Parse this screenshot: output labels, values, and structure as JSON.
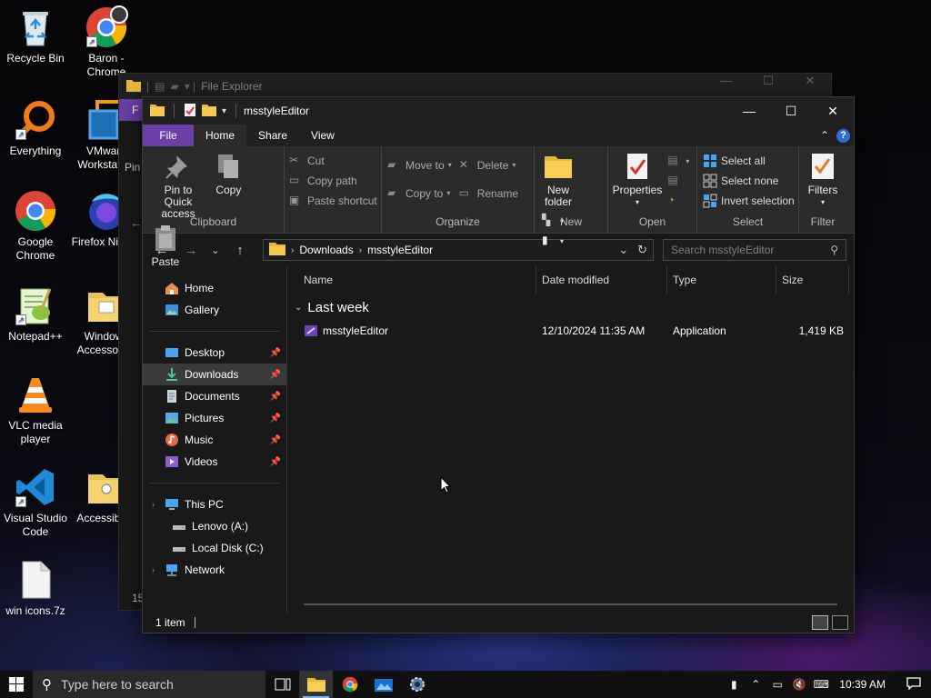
{
  "desktop": {
    "icons": [
      {
        "label": "Recycle Bin",
        "icon": "recycle-bin-icon"
      },
      {
        "label": "Baron - Chrome",
        "icon": "chrome-profile-icon"
      },
      {
        "label": "Everything",
        "icon": "everything-search-icon"
      },
      {
        "label": "VMware Workstation",
        "icon": "vmware-icon"
      },
      {
        "label": "Google Chrome",
        "icon": "chrome-icon"
      },
      {
        "label": "Firefox Nightly",
        "icon": "firefox-nightly-icon"
      },
      {
        "label": "Notepad++",
        "icon": "notepad-plus-plus-icon"
      },
      {
        "label": "Windows Accessories",
        "icon": "folder-icon"
      },
      {
        "label": "VLC media player",
        "icon": "vlc-icon"
      },
      {
        "label": "Visual Studio Code",
        "icon": "vscode-icon"
      },
      {
        "label": "Accessibility",
        "icon": "folder-icon"
      },
      {
        "label": "win icons.7z",
        "icon": "archive-file-icon"
      }
    ]
  },
  "background_window": {
    "title": "File Explorer",
    "ribbon_tab_fragment": "F",
    "pin_fragment": "Pin",
    "status_fragment": "15"
  },
  "window": {
    "title": "msstyleEditor",
    "controls": {
      "minimize": "—",
      "maximize": "☐",
      "close": "✕"
    },
    "tabs": [
      {
        "label": "File"
      },
      {
        "label": "Home"
      },
      {
        "label": "Share"
      },
      {
        "label": "View"
      }
    ],
    "help": "?",
    "ribbon": {
      "clipboard": {
        "label": "Clipboard",
        "pin": "Pin to Quick access",
        "copy": "Copy",
        "paste": "Paste",
        "cut": "Cut",
        "copy_path": "Copy path",
        "paste_shortcut": "Paste shortcut"
      },
      "organize": {
        "label": "Organize",
        "move_to": "Move to",
        "copy_to": "Copy to",
        "delete": "Delete",
        "rename": "Rename"
      },
      "new": {
        "label": "New",
        "new_folder": "New folder"
      },
      "open": {
        "label": "Open",
        "properties": "Properties"
      },
      "select": {
        "label": "Select",
        "select_all": "Select all",
        "select_none": "Select none",
        "invert": "Invert selection"
      },
      "filter": {
        "label": "Filter",
        "filters": "Filters"
      }
    },
    "address": {
      "crumbs": [
        "Downloads",
        "msstyleEditor"
      ],
      "search_placeholder": "Search msstyleEditor"
    },
    "nav": {
      "home": "Home",
      "gallery": "Gallery",
      "desktop": "Desktop",
      "downloads": "Downloads",
      "documents": "Documents",
      "pictures": "Pictures",
      "music": "Music",
      "videos": "Videos",
      "this_pc": "This PC",
      "lenovo": "Lenovo (A:)",
      "local_disk": "Local Disk (C:)",
      "network": "Network"
    },
    "columns": [
      "Name",
      "Date modified",
      "Type",
      "Size"
    ],
    "group": "Last week",
    "files": [
      {
        "name": "msstyleEditor",
        "date": "12/10/2024 11:35 AM",
        "type": "Application",
        "size": "1,419 KB"
      }
    ],
    "status": "1 item"
  },
  "taskbar": {
    "search_placeholder": "Type here to search",
    "clock": "10:39 AM",
    "apps": [
      "task-view-icon",
      "file-explorer-icon",
      "chrome-icon",
      "photos-app-icon",
      "settings-app-icon"
    ]
  }
}
